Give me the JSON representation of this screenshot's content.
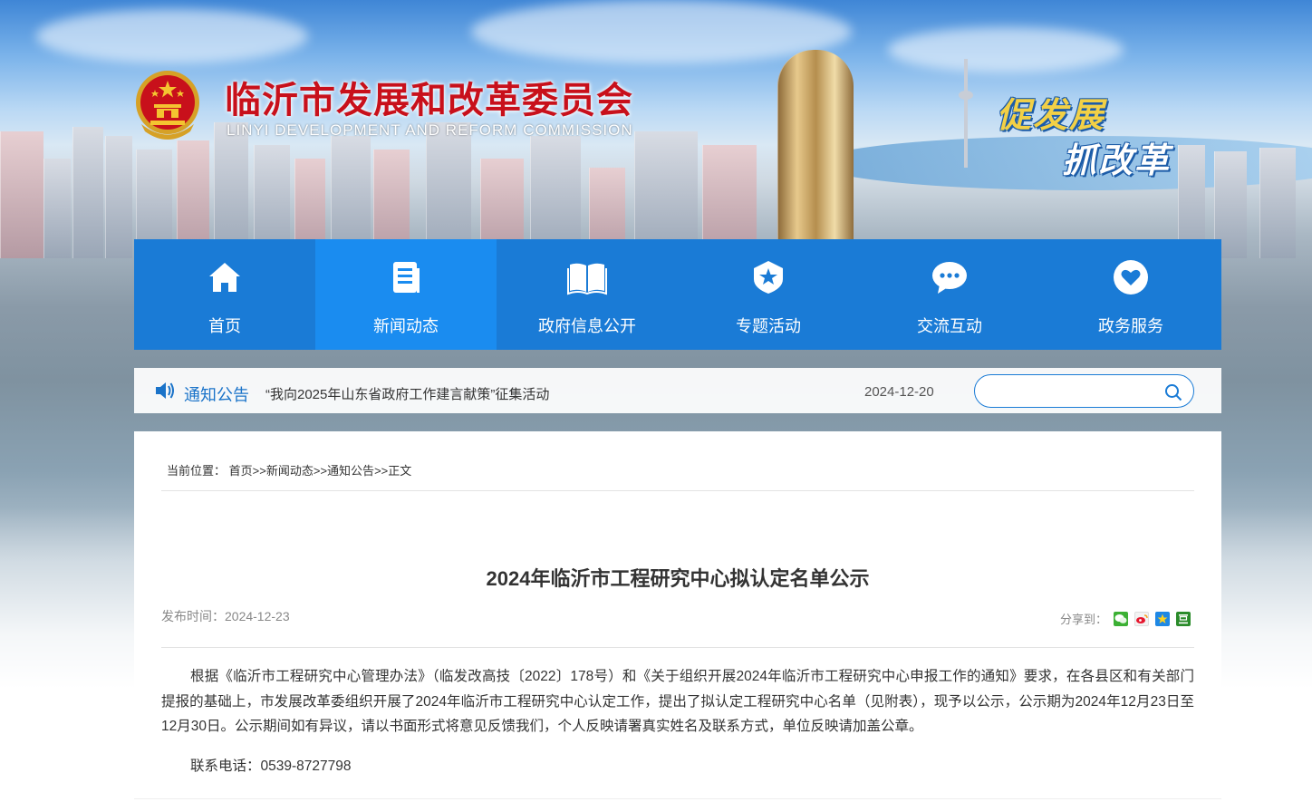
{
  "header": {
    "title": "临沂市发展和改革委员会",
    "subtitle": "LINYI DEVELOPMENT AND REFORM COMMISSION",
    "slogan_line1": "促发展",
    "slogan_line2": "抓改革"
  },
  "nav": {
    "items": [
      {
        "label": "首页",
        "icon": "home-icon",
        "active": false
      },
      {
        "label": "新闻动态",
        "icon": "document-icon",
        "active": true
      },
      {
        "label": "政府信息公开",
        "icon": "open-book-icon",
        "active": false
      },
      {
        "label": "专题活动",
        "icon": "star-badge-icon",
        "active": false
      },
      {
        "label": "交流互动",
        "icon": "chat-bubble-icon",
        "active": false
      },
      {
        "label": "政务服务",
        "icon": "heart-icon",
        "active": false
      }
    ]
  },
  "notice": {
    "title": "通知公告",
    "text": "“我向2025年山东省政府工作建言献策”征集活动",
    "date": "2024-12-20"
  },
  "search": {
    "placeholder": ""
  },
  "breadcrumb": {
    "prefix": "当前位置：",
    "home": "首页",
    "sep": ">>",
    "news": "新闻动态",
    "notices": "通知公告",
    "current": "正文"
  },
  "article": {
    "title": "2024年临沂市工程研究中心拟认定名单公示",
    "pub_label": "发布时间：",
    "pub_date": "2024-12-23",
    "share_label": "分享到：",
    "share_icons": [
      "wechat-icon",
      "weibo-icon",
      "qzone-icon",
      "douban-icon"
    ],
    "body": "根据《临沂市工程研究中心管理办法》（临发改高技〔2022〕178号）和《关于组织开展2024年临沂市工程研究中心申报工作的通知》要求，在各县区和有关部门提报的基础上，市发展改革委组织开展了2024年临沂市工程研究中心认定工作，提出了拟认定工程研究中心名单（见附表），现予以公示，公示期为2024年12月23日至12月30日。公示期间如有异议，请以书面形式将意见反馈我们，个人反映请署真实姓名及联系方式，单位反映请加盖公章。",
    "contact_label": "联系电话：",
    "contact_phone": "0539-8727798"
  },
  "colors": {
    "nav_bg": "#1a7bd6",
    "nav_active": "#1a8cf0",
    "title_red": "#c8101b",
    "notice_blue": "#1a73c9"
  }
}
